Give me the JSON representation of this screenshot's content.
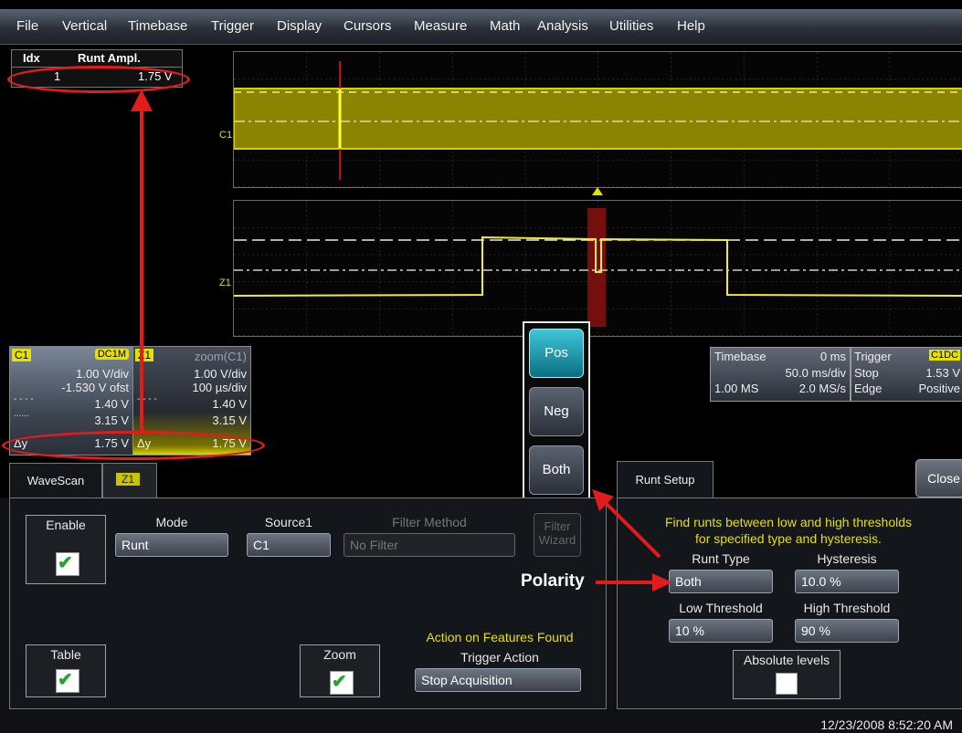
{
  "menu": [
    "File",
    "Vertical",
    "Timebase",
    "Trigger",
    "Display",
    "Cursors",
    "Measure",
    "Math",
    "Analysis",
    "Utilities",
    "Help"
  ],
  "measure_table": {
    "col1": "Idx",
    "col2": "Runt Ampl.",
    "row_idx": "1",
    "row_val": "1.75 V"
  },
  "trace_labels": {
    "upper": "C1",
    "lower": "Z1"
  },
  "c1_panel": {
    "name": "C1",
    "coupling": "DC1M",
    "vdiv": "1.00 V/div",
    "offset": "-1.530 V ofst",
    "lvl1": "1.40 V",
    "lvl2": "3.15 V",
    "dy_label": "Δy",
    "dy_val": "1.75 V"
  },
  "z1_panel": {
    "name": "Z1",
    "title": "zoom(C1)",
    "vdiv": "1.00 V/div",
    "tdiv": "100 µs/div",
    "lvl1": "1.40 V",
    "lvl2": "3.15 V",
    "dy_label": "Δy",
    "dy_val": "1.75 V"
  },
  "polarity_buttons": [
    "Pos",
    "Neg",
    "Both"
  ],
  "timebase": {
    "title": "Timebase",
    "delay": "0 ms",
    "tdiv": "50.0 ms/div",
    "samples": "1.00 MS",
    "rate": "2.0 MS/s"
  },
  "trigger": {
    "title": "Trigger",
    "chan": "C1DC",
    "mode": "Stop",
    "level": "1.53 V",
    "type": "Edge",
    "slope": "Positive"
  },
  "wavescan": {
    "tab": "WaveScan",
    "tab2": "Z1",
    "enable_label": "Enable",
    "mode_label": "Mode",
    "mode_val": "Runt",
    "source_label": "Source1",
    "source_val": "C1",
    "filter_label": "Filter Method",
    "filter_val": "No Filter",
    "filter_wizard_1": "Filter",
    "filter_wizard_2": "Wizard",
    "table_label": "Table",
    "zoom_label": "Zoom",
    "action_title": "Action on Features Found",
    "trigger_action": "Trigger Action",
    "trigger_action_val": "Stop Acquisition"
  },
  "runt_setup": {
    "tab": "Runt Setup",
    "close": "Close",
    "desc1": "Find runts between low and high thresholds",
    "desc2": "for specified type and hysteresis.",
    "type_label": "Runt Type",
    "type_val": "Both",
    "hyst_label": "Hysteresis",
    "hyst_val": "10.0 %",
    "low_label": "Low Threshold",
    "low_val": "10 %",
    "high_label": "High Threshold",
    "high_val": "90 %",
    "abs_label": "Absolute levels"
  },
  "annotation": "Polarity",
  "timestamp": "12/23/2008 8:52:20 AM",
  "colors": {
    "trace": "#e6e000",
    "annotation": "#e21b1b",
    "active_button": "#3fc6d8"
  }
}
